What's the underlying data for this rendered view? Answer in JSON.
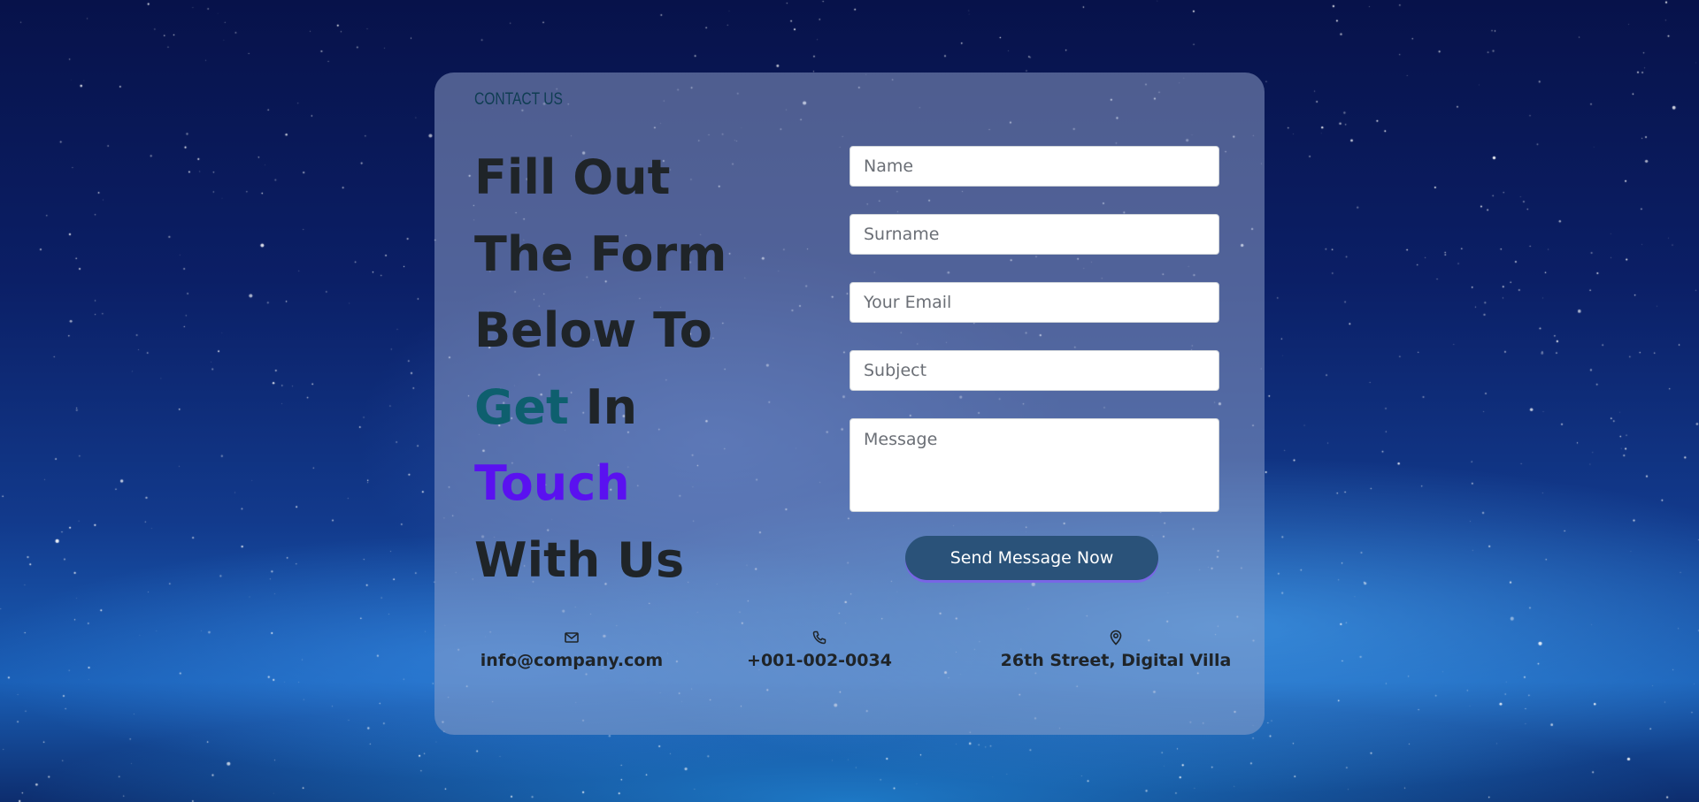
{
  "contact": {
    "eyebrow": "CONTACT US",
    "headline": {
      "line1": "Fill Out",
      "line2": "The Form",
      "line3": "Below To",
      "line4_accent": "Get",
      "line4_rest": " In",
      "line5": "Touch",
      "line6": "With Us"
    },
    "colors": {
      "accent_get": "#0e5f6e",
      "accent_touch": "#5a11f0",
      "button": "#2a5279"
    }
  },
  "form": {
    "name_placeholder": "Name",
    "surname_placeholder": "Surname",
    "email_placeholder": "Your Email",
    "subject_placeholder": "Subject",
    "message_placeholder": "Message",
    "submit_label": "Send Message Now"
  },
  "info": {
    "email": {
      "icon": "envelope-icon",
      "text": "info@company.com"
    },
    "phone": {
      "icon": "phone-icon",
      "text": "+001-002-0034"
    },
    "address": {
      "icon": "map-pin-icon",
      "text": "26th Street, Digital Villa"
    }
  }
}
